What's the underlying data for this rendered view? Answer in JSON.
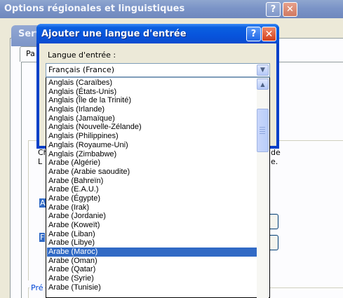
{
  "bg_window": {
    "title": "Options régionales et linguistiques",
    "help_glyph": "?",
    "close_glyph": "✕",
    "tab_fragment": "Pa",
    "fragments": {
      "c": "Ch",
      "l": "L",
      "a": "A",
      "f": "F",
      "de": "de",
      "e": "e."
    },
    "pre_label": "Pré"
  },
  "mid_window": {
    "title": "Serv"
  },
  "dialog": {
    "title": "Ajouter une langue d'entrée",
    "help_glyph": "?",
    "close_glyph": "✕",
    "input_language_label": "Langue d'entrée :",
    "selected_value": "Français (France)",
    "dropdown_arrow": "▼",
    "scroll_up_arrow": "▲",
    "list_items": [
      "Anglais (Caraïbes)",
      "Anglais (États-Unis)",
      "Anglais (Île de la Trinité)",
      "Anglais (Irlande)",
      "Anglais (Jamaïque)",
      "Anglais (Nouvelle-Zélande)",
      "Anglais (Philippines)",
      "Anglais (Royaume-Uni)",
      "Anglais (Zimbabwe)",
      "Arabe (Algérie)",
      "Arabe (Arabie saoudite)",
      "Arabe (Bahreïn)",
      "Arabe (E.A.U.)",
      "Arabe (Égypte)",
      "Arabe (Irak)",
      "Arabe (Jordanie)",
      "Arabe (Koweït)",
      "Arabe (Liban)",
      "Arabe (Libye)",
      "Arabe (Maroc)",
      "Arabe (Oman)",
      "Arabe (Qatar)",
      "Arabe (Syrie)",
      "Arabe (Tunisie)"
    ],
    "highlighted_item": "Arabe (Maroc)",
    "colors": {
      "titlebar": "#0a5fe0",
      "selection": "#316ac5",
      "close_button": "#d4401c"
    }
  }
}
